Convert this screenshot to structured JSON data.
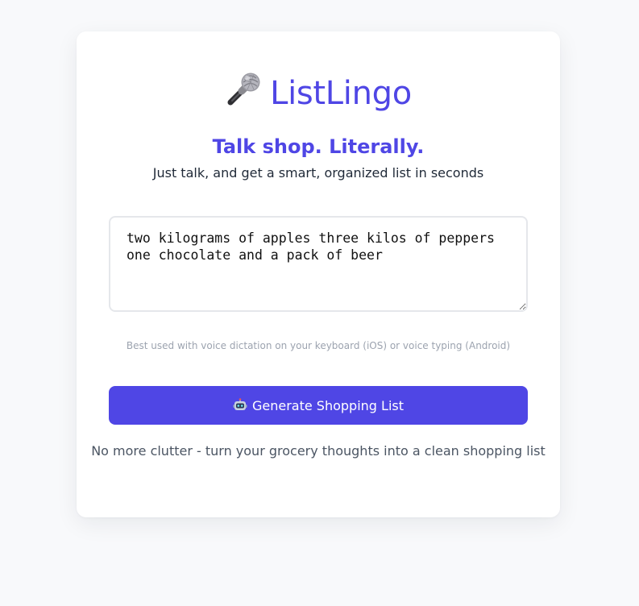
{
  "app": {
    "title": "ListLingo",
    "title_icon": "microphone-icon",
    "tagline": "Talk shop. Literally.",
    "subtitle": "Just talk, and get a smart, organized list in seconds"
  },
  "input": {
    "value": "two kilograms of apples three kilos of peppers one chocolate and a pack of beer",
    "hint": "Best used with voice dictation on your keyboard (iOS) or voice typing (Android)"
  },
  "generate_button": {
    "icon": "robot-icon",
    "label": "Generate Shopping List"
  },
  "footer": {
    "note": "No more clutter - turn your grocery thoughts into a clean shopping list"
  },
  "colors": {
    "accent": "#4f46e5",
    "background": "#f8f9fb",
    "card": "#ffffff"
  }
}
